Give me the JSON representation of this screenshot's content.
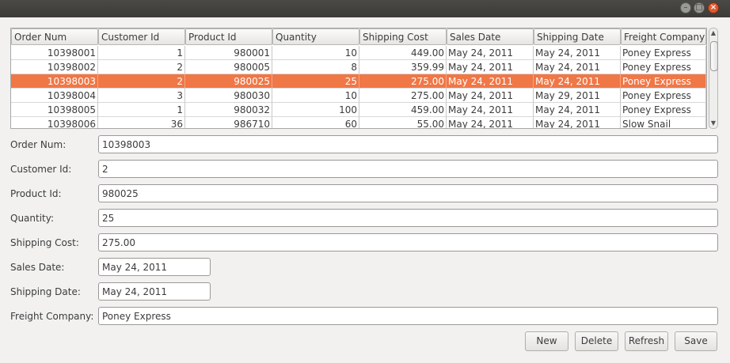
{
  "window": {
    "buttons": [
      "minimize",
      "maximize",
      "close"
    ]
  },
  "table": {
    "columns": [
      "Order Num",
      "Customer Id",
      "Product Id",
      "Quantity",
      "Shipping Cost",
      "Sales Date",
      "Shipping Date",
      "Freight Company"
    ],
    "rows": [
      [
        "10398001",
        "1",
        "980001",
        "10",
        "449.00",
        "May 24, 2011",
        "May 24, 2011",
        "Poney Express"
      ],
      [
        "10398002",
        "2",
        "980005",
        "8",
        "359.99",
        "May 24, 2011",
        "May 24, 2011",
        "Poney Express"
      ],
      [
        "10398003",
        "2",
        "980025",
        "25",
        "275.00",
        "May 24, 2011",
        "May 24, 2011",
        "Poney Express"
      ],
      [
        "10398004",
        "3",
        "980030",
        "10",
        "275.00",
        "May 24, 2011",
        "May 29, 2011",
        "Poney Express"
      ],
      [
        "10398005",
        "1",
        "980032",
        "100",
        "459.00",
        "May 24, 2011",
        "May 24, 2011",
        "Poney Express"
      ],
      [
        "10398006",
        "36",
        "986710",
        "60",
        "55.00",
        "May 24, 2011",
        "May 24, 2011",
        "Slow Snail"
      ]
    ],
    "selected_row": 2,
    "selection_color": "#f07746"
  },
  "form": {
    "order_num_label": "Order Num:",
    "order_num": "10398003",
    "customer_id_label": "Customer Id:",
    "customer_id": "2",
    "product_id_label": "Product Id:",
    "product_id": "980025",
    "quantity_label": "Quantity:",
    "quantity": "25",
    "shipping_cost_label": "Shipping Cost:",
    "shipping_cost": "275.00",
    "sales_date_label": "Sales Date:",
    "sales_date": "May 24, 2011",
    "shipping_date_label": "Shipping Date:",
    "shipping_date": "May 24, 2011",
    "freight_company_label": "Freight Company:",
    "freight_company": "Poney Express"
  },
  "buttons": {
    "new": "New",
    "delete": "Delete",
    "refresh": "Refresh",
    "save": "Save"
  }
}
